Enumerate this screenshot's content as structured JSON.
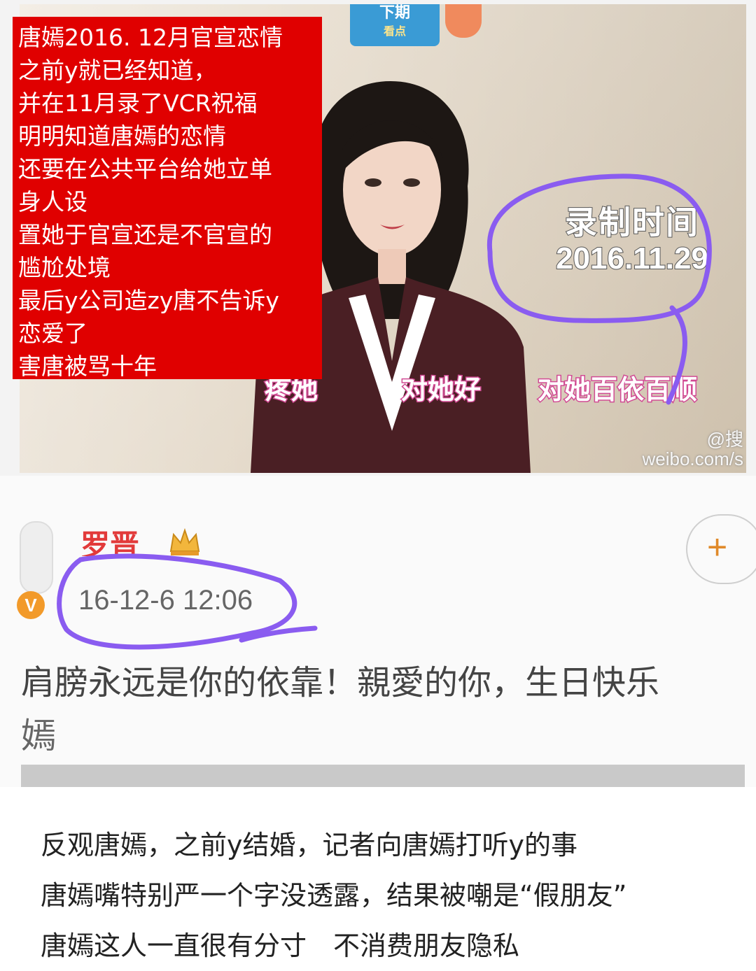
{
  "red_box": {
    "lines": [
      "唐嫣2016. 12月官宣恋情",
      "之前y就已经知道，",
      "并在11月录了VCR祝福",
      "明明知道唐嫣的恋情",
      "还要在公共平台给她立单",
      "身人设",
      "置她于官宣还是不官宣的",
      "尴尬处境",
      "最后y公司造zy唐不告诉y",
      "恋爱了",
      "害唐被骂十年"
    ]
  },
  "video": {
    "badge_line1": "下期",
    "badge_line2": "看点",
    "recording_label": "录制时间",
    "recording_date": "2016.11.29",
    "tags": [
      "疼她",
      "对她好",
      "对她百依百顺"
    ],
    "watermark_line1": "@搜",
    "watermark_line2": "weibo.com/s"
  },
  "post": {
    "username": "罗晋",
    "verified_badge": "V",
    "follow_label": "+",
    "timestamp": "16-12-6 12:06",
    "text_line1": "肩膀永远是你的依靠！親愛的你，生日快乐",
    "text_line2": "嫣"
  },
  "caption": {
    "lines": [
      "反观唐嫣，之前y结婚，记者向唐嫣打听y的事",
      "唐嫣嘴特别严一个字没透露，结果被嘲是“假朋友”",
      "唐嫣这人一直很有分寸　不消费朋友隐私"
    ]
  },
  "colors": {
    "red_box": "#e00000",
    "annotation_purple": "#8a5cf0",
    "username_red": "#e23a3a",
    "tag_pink": "#d14a93"
  },
  "icons": [
    "crown-icon",
    "verified-icon",
    "plus-icon"
  ]
}
